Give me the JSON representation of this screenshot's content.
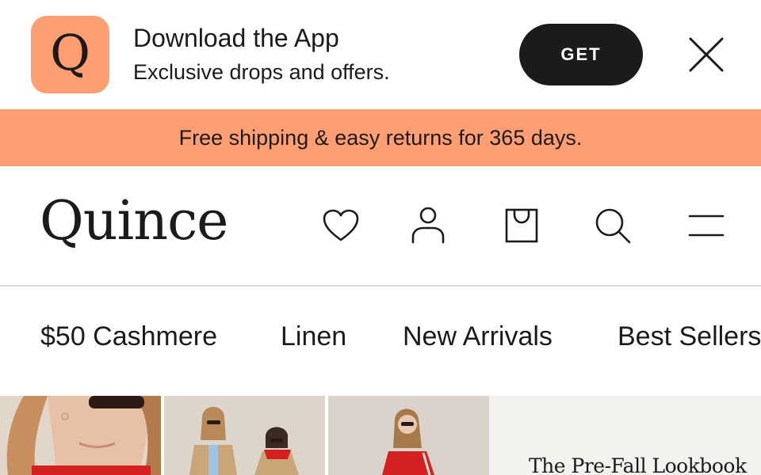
{
  "app_banner": {
    "logo_letter": "Q",
    "title": "Download the App",
    "subtitle": "Exclusive drops and offers.",
    "get_label": "GET",
    "logo_color": "#ff9e72",
    "close_icon": "close-icon"
  },
  "promo": {
    "text": "Free shipping & easy returns for 365 days.",
    "background": "#ff9e72"
  },
  "header": {
    "brand": "Quince",
    "icons": [
      "heart-icon",
      "account-icon",
      "bag-icon",
      "search-icon",
      "menu-icon"
    ]
  },
  "nav": {
    "items": [
      "$50 Cashmere",
      "Linen",
      "New Arrivals",
      "Best Sellers"
    ]
  },
  "hero": {
    "lookbook_title": "The Pre-Fall Lookbook"
  }
}
